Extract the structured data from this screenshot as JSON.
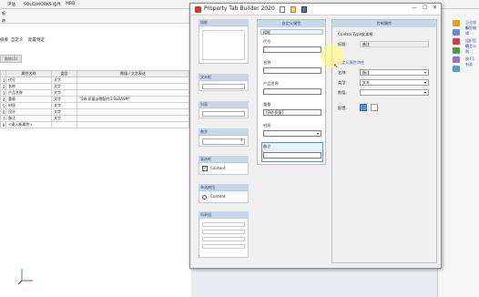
{
  "background": {
    "tabs": [
      "评估",
      "SOLIDWORKS 插件",
      "MBD"
    ],
    "sub_items": [
      "板",
      "跨"
    ],
    "left_tabs": [
      "摘要",
      "自定义",
      "配置特定"
    ],
    "delete_button": "删除(D)",
    "table": {
      "headers": [
        "",
        "属性名称",
        "类型",
        "数值 / 文字表达"
      ],
      "rows": [
        [
          "1",
          "代号",
          "文字",
          ""
        ],
        [
          "2",
          "名称",
          "文字",
          ""
        ],
        [
          "3",
          "产品名称",
          "文字",
          ""
        ],
        [
          "4",
          "重量",
          "文字",
          "\"SW-质量@零配件3.SLDASM\""
        ],
        [
          "5",
          "材质",
          "文字",
          ""
        ],
        [
          "6",
          "设计",
          "文字",
          ""
        ],
        [
          "7",
          "备注",
          "文字",
          ""
        ],
        [
          "8",
          "<键入新属性>",
          "",
          ""
        ]
      ]
    },
    "right_lines": [
      "当全部新",
      "标签编辑",
      "",
      "组织您的",
      "您定义和",
      "",
      "按 F1 有关"
    ]
  },
  "dialog": {
    "title": "Property Tab Builder 2020",
    "palette": {
      "items": [
        {
          "label": "组框"
        },
        {
          "label": "文本框"
        },
        {
          "label": "列表"
        },
        {
          "label": "数字"
        },
        {
          "label": "复选框",
          "content": "Content"
        },
        {
          "label": "单选按钮",
          "content": "Content"
        },
        {
          "label": "列表组"
        }
      ]
    },
    "center": {
      "header": "自定义属性",
      "group_title": "组框",
      "fields": [
        {
          "label": "代号",
          "value": ""
        },
        {
          "label": "名称",
          "value": ""
        },
        {
          "label": "产品名称",
          "value": ""
        },
        {
          "label": "重量",
          "value": "[SW-质量]"
        },
        {
          "label": "材质",
          "value": ""
        },
        {
          "label": "备注",
          "value": ""
        }
      ]
    },
    "right": {
      "header": "控制属性",
      "control_type_label": "Control Type:",
      "control_type_value": "文本框",
      "caption_label": "标题:",
      "caption_value": "备注",
      "section_title": "自定义属性特性",
      "name_label": "名称:",
      "name_value": "备注",
      "type_label": "类型:",
      "type_value": "文本",
      "value_label": "数值:",
      "value_value": "",
      "config_label": "配置:"
    }
  }
}
